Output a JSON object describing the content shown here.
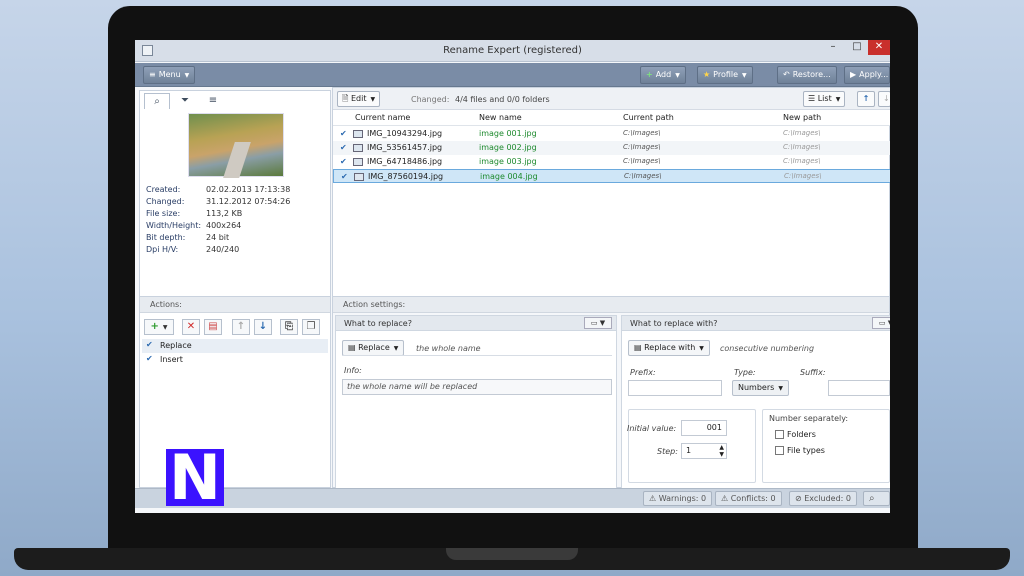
{
  "window": {
    "title": "Rename Expert (registered)",
    "min": "–",
    "max": "□",
    "close": "✕"
  },
  "toolbar": {
    "menu": "Menu",
    "add": "Add",
    "profile": "Profile",
    "restore": "Restore...",
    "apply": "Apply..."
  },
  "left": {
    "tabs": [
      "⌕",
      "⏷",
      "≡"
    ],
    "meta": [
      {
        "key": "Created:",
        "val": "02.02.2013 17:13:38"
      },
      {
        "key": "Changed:",
        "val": "31.12.2012 07:54:26"
      },
      {
        "key": "File size:",
        "val": "113,2 KB"
      },
      {
        "key": "Width/Height:",
        "val": "400x264"
      },
      {
        "key": "Bit depth:",
        "val": "24 bit"
      },
      {
        "key": "Dpi H/V:",
        "val": "240/240"
      }
    ]
  },
  "files": {
    "edit": "Edit",
    "changed_label": "Changed:",
    "changed_value": "4/4 files and 0/0 folders",
    "view": "List",
    "columns": [
      "Current name",
      "New name",
      "Current path",
      "New path"
    ],
    "rows": [
      {
        "check": "✔",
        "current": "IMG_10943294.jpg",
        "new": "image 001.jpg",
        "cpath": "C:\\Images\\",
        "npath": "C:\\Images\\"
      },
      {
        "check": "✔",
        "current": "IMG_53561457.jpg",
        "new": "image 002.jpg",
        "cpath": "C:\\Images\\",
        "npath": "C:\\Images\\"
      },
      {
        "check": "✔",
        "current": "IMG_64718486.jpg",
        "new": "image 003.jpg",
        "cpath": "C:\\Images\\",
        "npath": "C:\\Images\\"
      },
      {
        "check": "✔",
        "current": "IMG_87560194.jpg",
        "new": "image 004.jpg",
        "cpath": "C:\\Images\\",
        "npath": "C:\\Images\\"
      }
    ]
  },
  "actions": {
    "header": "Actions:",
    "items": [
      {
        "check": "✔",
        "label": "Replace"
      },
      {
        "check": "✔",
        "label": "Insert"
      }
    ]
  },
  "settings": {
    "header": "Action settings:",
    "what": {
      "title": "What to replace?",
      "mode": "Replace",
      "mode_hint": "the whole name",
      "info_label": "Info:",
      "info_text": "the whole name will be replaced"
    },
    "with": {
      "title": "What to replace with?",
      "mode": "Replace with",
      "mode_hint": "consecutive numbering",
      "prefix_label": "Prefix:",
      "prefix_value": "",
      "type_label": "Type:",
      "type_value": "Numbers",
      "suffix_label": "Suffix:",
      "suffix_value": "",
      "initial_label": "Initial value:",
      "initial_value": "001",
      "step_label": "Step:",
      "step_value": "1",
      "separately_label": "Number separately:",
      "folders": "Folders",
      "filetypes": "File types"
    }
  },
  "status": {
    "warnings": "Warnings: 0",
    "conflicts": "Conflicts: 0",
    "excluded": "Excluded: 0"
  },
  "logo": {
    "text": "N"
  },
  "colors": {
    "accent": "#2c6ab0",
    "new_name": "#1e8a2e",
    "toolbar": "#7a8ca6",
    "close": "#c9302c",
    "logo": "#3b12ff"
  }
}
